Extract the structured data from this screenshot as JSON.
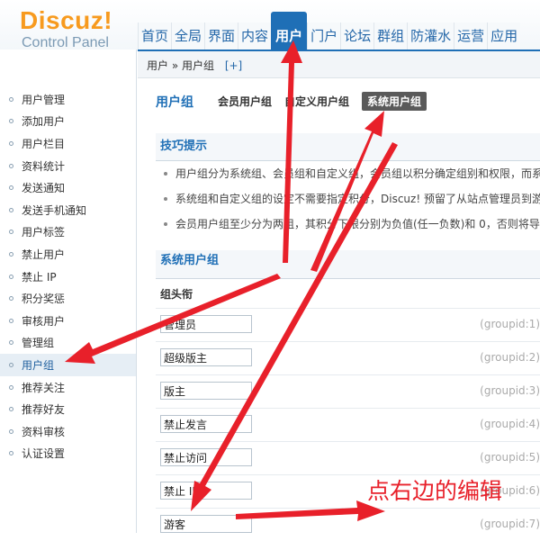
{
  "logo": {
    "title": "Discuz!",
    "subtitle": "Control Panel"
  },
  "nav": {
    "items": [
      {
        "label": "首页"
      },
      {
        "label": "全局"
      },
      {
        "label": "界面"
      },
      {
        "label": "内容"
      },
      {
        "label": "用户",
        "active": true
      },
      {
        "label": "门户"
      },
      {
        "label": "论坛"
      },
      {
        "label": "群组"
      },
      {
        "label": "防灌水"
      },
      {
        "label": "运营"
      },
      {
        "label": "应用"
      }
    ]
  },
  "breadcrumb": {
    "path": "用户 » 用户组",
    "add": "[+]"
  },
  "sidebar": {
    "items": [
      {
        "label": "用户管理"
      },
      {
        "label": "添加用户"
      },
      {
        "label": "用户栏目"
      },
      {
        "label": "资料统计"
      },
      {
        "label": "发送通知"
      },
      {
        "label": "发送手机通知"
      },
      {
        "label": "用户标签"
      },
      {
        "label": "禁止用户"
      },
      {
        "label": "禁止 IP"
      },
      {
        "label": "积分奖惩"
      },
      {
        "label": "审核用户"
      },
      {
        "label": "管理组"
      },
      {
        "label": "用户组",
        "active": true
      },
      {
        "label": "推荐关注"
      },
      {
        "label": "推荐好友"
      },
      {
        "label": "资料审核"
      },
      {
        "label": "认证设置"
      }
    ]
  },
  "tabs": {
    "title": "用户组",
    "items": [
      {
        "label": "会员用户组"
      },
      {
        "label": "自定义用户组"
      },
      {
        "label": "系统用户组",
        "active": true
      }
    ]
  },
  "tips": {
    "title": "技巧提示",
    "items": [
      "用户组分为系统组、会员组和自定义组，会员组以积分确定组别和权限，而系统",
      "系统组和自定义组的设定不需要指定积分，Discuz! 预留了从站点管理员到游客",
      "会员用户组至少分为两组，其积分下限分别为负值(任一负数)和 0，否则将导致"
    ]
  },
  "system_groups": {
    "title": "系统用户组",
    "column_header": "组头衔",
    "rows": [
      {
        "name": "管理员",
        "gid": "(groupid:1)"
      },
      {
        "name": "超级版主",
        "gid": "(groupid:2)"
      },
      {
        "name": "版主",
        "gid": "(groupid:3)"
      },
      {
        "name": "禁止发言",
        "gid": "(groupid:4)"
      },
      {
        "name": "禁止访问",
        "gid": "(groupid:5)"
      },
      {
        "name": "禁止 IP",
        "gid": "(groupid:6)"
      },
      {
        "name": "游客",
        "gid": "(groupid:7)"
      }
    ]
  },
  "annotation": {
    "text": "点右边的编辑"
  },
  "colors": {
    "accent": "#1f6fb6",
    "logo": "#f79a1e",
    "arrow": "#e8202a"
  }
}
